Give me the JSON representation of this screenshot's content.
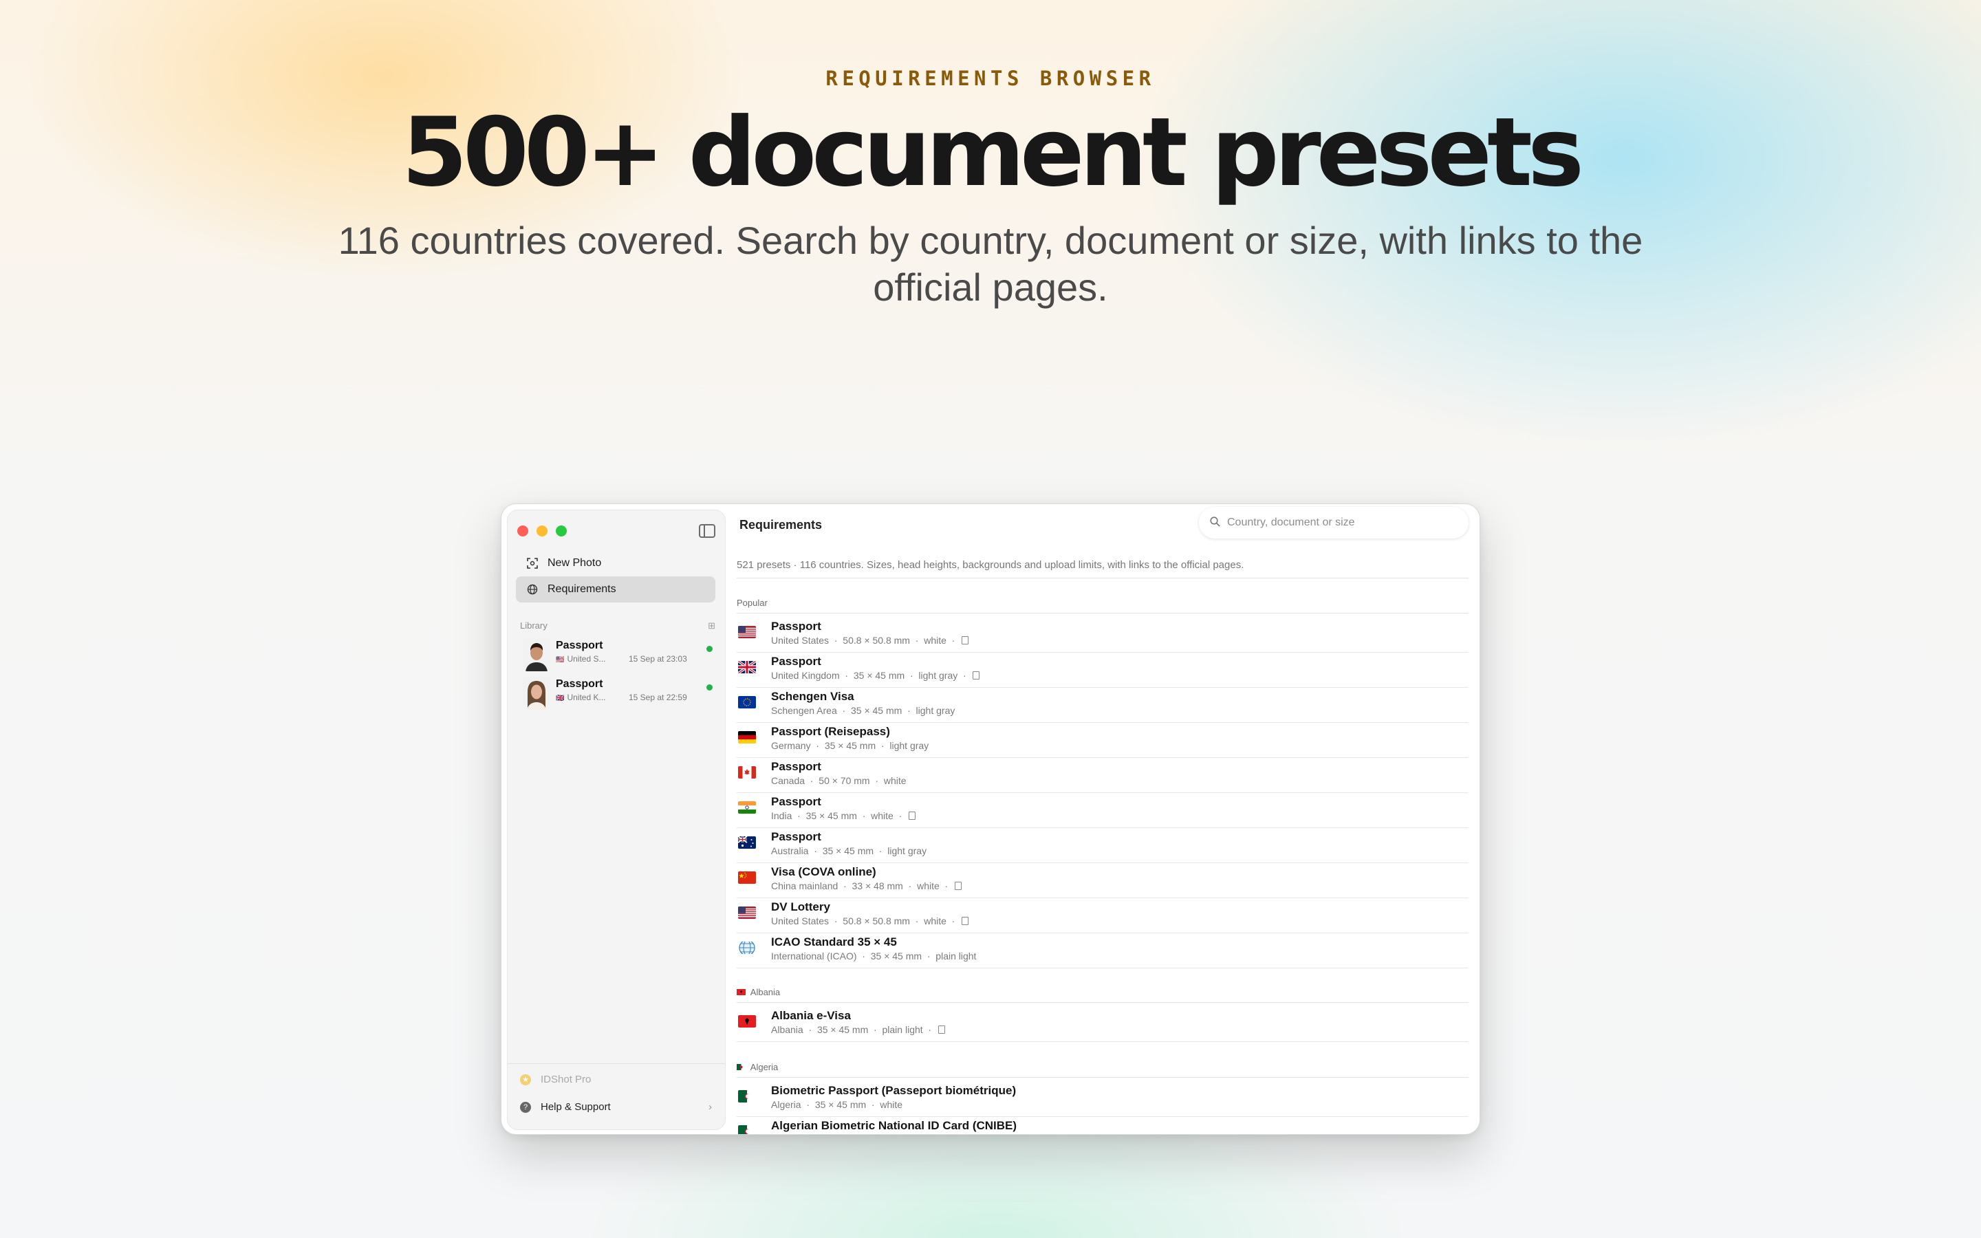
{
  "hero": {
    "eyebrow": "REQUIREMENTS BROWSER",
    "headline": "500+ document presets",
    "subtitle": "116 countries covered. Search by country, document or size, with links to the official pages."
  },
  "sidebar": {
    "nav": [
      {
        "label": "New Photo",
        "icon": "camera-viewfinder-icon"
      },
      {
        "label": "Requirements",
        "icon": "globe-icon"
      }
    ],
    "library_label": "Library",
    "library": [
      {
        "title": "Passport",
        "flag": "🇺🇸",
        "country": "United S...",
        "date": "15 Sep at 23:03"
      },
      {
        "title": "Passport",
        "flag": "🇬🇧",
        "country": "United K...",
        "date": "15 Sep at 22:59"
      }
    ],
    "footer": {
      "pro": "IDShot Pro",
      "help": "Help & Support"
    }
  },
  "main": {
    "title": "Requirements",
    "search_placeholder": "Country, document or size",
    "description": "521 presets · 116 countries. Sizes, head heights, backgrounds and upload limits, with links to the official pages.",
    "popular_label": "Popular",
    "popular": [
      {
        "title": "Passport",
        "country": "United States",
        "size": "50.8 × 50.8 mm",
        "bg": "white",
        "doc": true,
        "flag": "us"
      },
      {
        "title": "Passport",
        "country": "United Kingdom",
        "size": "35 × 45 mm",
        "bg": "light gray",
        "doc": true,
        "flag": "gb"
      },
      {
        "title": "Schengen Visa",
        "country": "Schengen Area",
        "size": "35 × 45 mm",
        "bg": "light gray",
        "doc": false,
        "flag": "eu"
      },
      {
        "title": "Passport (Reisepass)",
        "country": "Germany",
        "size": "35 × 45 mm",
        "bg": "light gray",
        "doc": false,
        "flag": "de"
      },
      {
        "title": "Passport",
        "country": "Canada",
        "size": "50 × 70 mm",
        "bg": "white",
        "doc": false,
        "flag": "ca"
      },
      {
        "title": "Passport",
        "country": "India",
        "size": "35 × 45 mm",
        "bg": "white",
        "doc": true,
        "flag": "in"
      },
      {
        "title": "Passport",
        "country": "Australia",
        "size": "35 × 45 mm",
        "bg": "light gray",
        "doc": false,
        "flag": "au"
      },
      {
        "title": "Visa (COVA online)",
        "country": "China mainland",
        "size": "33 × 48 mm",
        "bg": "white",
        "doc": true,
        "flag": "cn"
      },
      {
        "title": "DV Lottery",
        "country": "United States",
        "size": "50.8 × 50.8 mm",
        "bg": "white",
        "doc": true,
        "flag": "us"
      },
      {
        "title": "ICAO Standard 35 × 45",
        "country": "International (ICAO)",
        "size": "35 × 45 mm",
        "bg": "plain light",
        "doc": false,
        "flag": "globe"
      }
    ],
    "albania_label": "Albania",
    "albania": [
      {
        "title": "Albania e-Visa",
        "country": "Albania",
        "size": "35 × 45 mm",
        "bg": "plain light",
        "doc": true,
        "flag": "al"
      }
    ],
    "algeria_label": "Algeria",
    "algeria": [
      {
        "title": "Biometric Passport (Passeport biométrique)",
        "country": "Algeria",
        "size": "35 × 45 mm",
        "bg": "white",
        "doc": false,
        "flag": "dz"
      },
      {
        "title": "Algerian Biometric National ID Card (CNIBE)",
        "country": "",
        "size": "",
        "bg": "",
        "doc": false,
        "flag": "dz"
      }
    ]
  }
}
